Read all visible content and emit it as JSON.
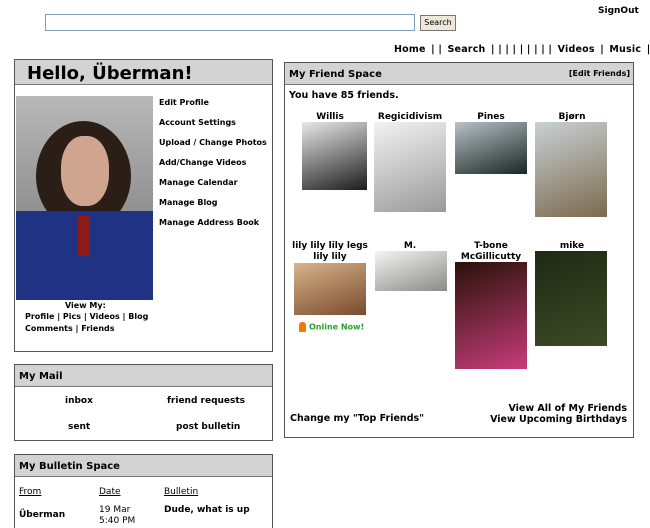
{
  "header": {
    "signout": "SignOut",
    "search_value": "",
    "search_button": "Search"
  },
  "topnav": {
    "items": [
      "Home",
      "Search",
      "Videos",
      "Music"
    ],
    "separators": [
      "| |",
      "| | | | | | | | |",
      "|",
      "| |"
    ]
  },
  "profile": {
    "greeting": "Hello, Überman!",
    "menu": [
      "Edit Profile",
      "Account Settings",
      "Upload / Change Photos",
      "Add/Change Videos",
      "Manage Calendar",
      "Manage Blog",
      "Manage Address Book"
    ],
    "view_my_label": "View My:",
    "view_links": [
      "Profile",
      "Pics",
      "Videos",
      "Blog",
      "Comments",
      "Friends"
    ],
    "link_sep": "|"
  },
  "mail": {
    "title": "My Mail",
    "links": [
      "inbox",
      "friend requests",
      "sent",
      "post bulletin"
    ]
  },
  "bulletin": {
    "title": "My Bulletin Space",
    "headers": [
      "From",
      "Date",
      "Bulletin"
    ],
    "rows": [
      {
        "from": "Überman",
        "date1": "19 Mar",
        "date2": "5:40 PM",
        "bulletin": "Dude, what is up"
      }
    ]
  },
  "friends": {
    "title": "My Friend Space",
    "edit": "[Edit Friends]",
    "count_text": "You have 85 friends.",
    "list": [
      {
        "name": "Willis",
        "colors": [
          "#e8e8e8",
          "#1c1c1c"
        ]
      },
      {
        "name": "Regicidivism",
        "colors": [
          "#f2f2f2",
          "#9a9a9a"
        ]
      },
      {
        "name": "Pines",
        "colors": [
          "#b8c2c8",
          "#1a2622"
        ]
      },
      {
        "name": "Bjørn",
        "colors": [
          "#c8d0d4",
          "#7c6a4e"
        ]
      },
      {
        "name": "lily lily lily legs lily lily",
        "colors": [
          "#d6b48a",
          "#7a4a2e"
        ]
      },
      {
        "name": "M.",
        "colors": [
          "#f4f4f0",
          "#8a8a8a"
        ]
      },
      {
        "name": "T-bone McGillicutty",
        "colors": [
          "#2a1208",
          "#c63c7a"
        ]
      },
      {
        "name": "mike",
        "colors": [
          "#1e2a14",
          "#3c4a26"
        ]
      }
    ],
    "online_text": "Online Now!",
    "change_top": "Change my \"Top Friends\"",
    "view_all": "View All of My Friends",
    "view_birthdays": "View Upcoming Birthdays"
  }
}
